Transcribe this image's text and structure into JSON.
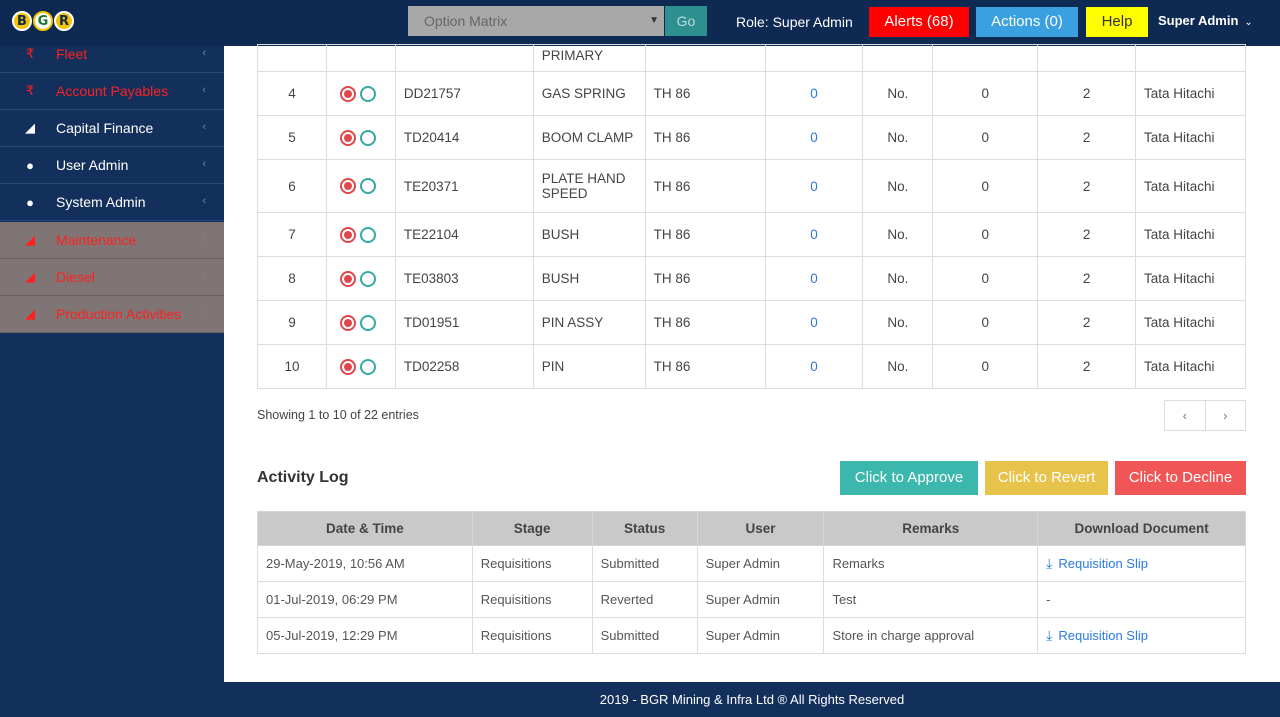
{
  "header": {
    "logo_letters": [
      "B",
      "G",
      "R"
    ],
    "option_select": "Option Matrix",
    "go_label": "Go",
    "role": "Role: Super Admin",
    "alerts_label": "Alerts (68)",
    "actions_label": "Actions (0)",
    "help_label": "Help",
    "user_name": "Super Admin"
  },
  "sidebar": {
    "items": [
      {
        "label": "Fleet",
        "icon": "rupee-icon"
      },
      {
        "label": "Account Payables",
        "icon": "rupee-icon"
      },
      {
        "label": "Capital Finance",
        "icon": "area-chart-icon"
      },
      {
        "label": "User Admin",
        "icon": "users-icon"
      },
      {
        "label": "System Admin",
        "icon": "users-icon"
      },
      {
        "label": "Maintenance",
        "icon": "area-chart-icon"
      },
      {
        "label": "Diesel",
        "icon": "area-chart-icon"
      },
      {
        "label": "Production Activities",
        "icon": "area-chart-icon"
      }
    ]
  },
  "items_table": {
    "partial_row_name": "PRIMARY",
    "rows": [
      {
        "no": "4",
        "code": "DD21757",
        "name": "GAS SPRING",
        "model": "TH 86",
        "qty": "0",
        "unit": "No.",
        "val": "0",
        "n": "2",
        "make": "Tata Hitachi"
      },
      {
        "no": "5",
        "code": "TD20414",
        "name": "BOOM CLAMP",
        "model": "TH 86",
        "qty": "0",
        "unit": "No.",
        "val": "0",
        "n": "2",
        "make": "Tata Hitachi"
      },
      {
        "no": "6",
        "code": "TE20371",
        "name": "PLATE HAND SPEED",
        "model": "TH 86",
        "qty": "0",
        "unit": "No.",
        "val": "0",
        "n": "2",
        "make": "Tata Hitachi"
      },
      {
        "no": "7",
        "code": "TE22104",
        "name": "BUSH",
        "model": "TH 86",
        "qty": "0",
        "unit": "No.",
        "val": "0",
        "n": "2",
        "make": "Tata Hitachi"
      },
      {
        "no": "8",
        "code": "TE03803",
        "name": "BUSH",
        "model": "TH 86",
        "qty": "0",
        "unit": "No.",
        "val": "0",
        "n": "2",
        "make": "Tata Hitachi"
      },
      {
        "no": "9",
        "code": "TD01951",
        "name": "PIN ASSY",
        "model": "TH 86",
        "qty": "0",
        "unit": "No.",
        "val": "0",
        "n": "2",
        "make": "Tata Hitachi"
      },
      {
        "no": "10",
        "code": "TD02258",
        "name": "PIN",
        "model": "TH 86",
        "qty": "0",
        "unit": "No.",
        "val": "0",
        "n": "2",
        "make": "Tata Hitachi"
      }
    ],
    "showing": "Showing 1 to 10 of 22 entries",
    "prev": "‹",
    "next": "›"
  },
  "activity": {
    "title": "Activity Log",
    "approve": "Click to Approve",
    "revert": "Click to Revert",
    "decline": "Click to Decline",
    "columns": [
      "Date & Time",
      "Stage",
      "Status",
      "User",
      "Remarks",
      "Download Document"
    ],
    "rows": [
      {
        "date": "29-May-2019, 10:56 AM",
        "stage": "Requisitions",
        "status": "Submitted",
        "user": "Super Admin",
        "remarks": "Remarks",
        "doc": "Requisition Slip"
      },
      {
        "date": "01-Jul-2019, 06:29 PM",
        "stage": "Requisitions",
        "status": "Reverted",
        "user": "Super Admin",
        "remarks": "Test",
        "doc": "-"
      },
      {
        "date": "05-Jul-2019, 12:29 PM",
        "stage": "Requisitions",
        "status": "Submitted",
        "user": "Super Admin",
        "remarks": "Store in charge approval",
        "doc": "Requisition Slip"
      }
    ]
  },
  "footer": "2019 - BGR Mining & Infra Ltd ® All Rights Reserved",
  "colors": {
    "navy": "#13305c",
    "alerts": "#ff0000",
    "actions": "#3aa0e0",
    "help": "#ffff00",
    "approve": "#3bb7ad",
    "revert": "#e8c34b",
    "decline": "#f05656"
  }
}
